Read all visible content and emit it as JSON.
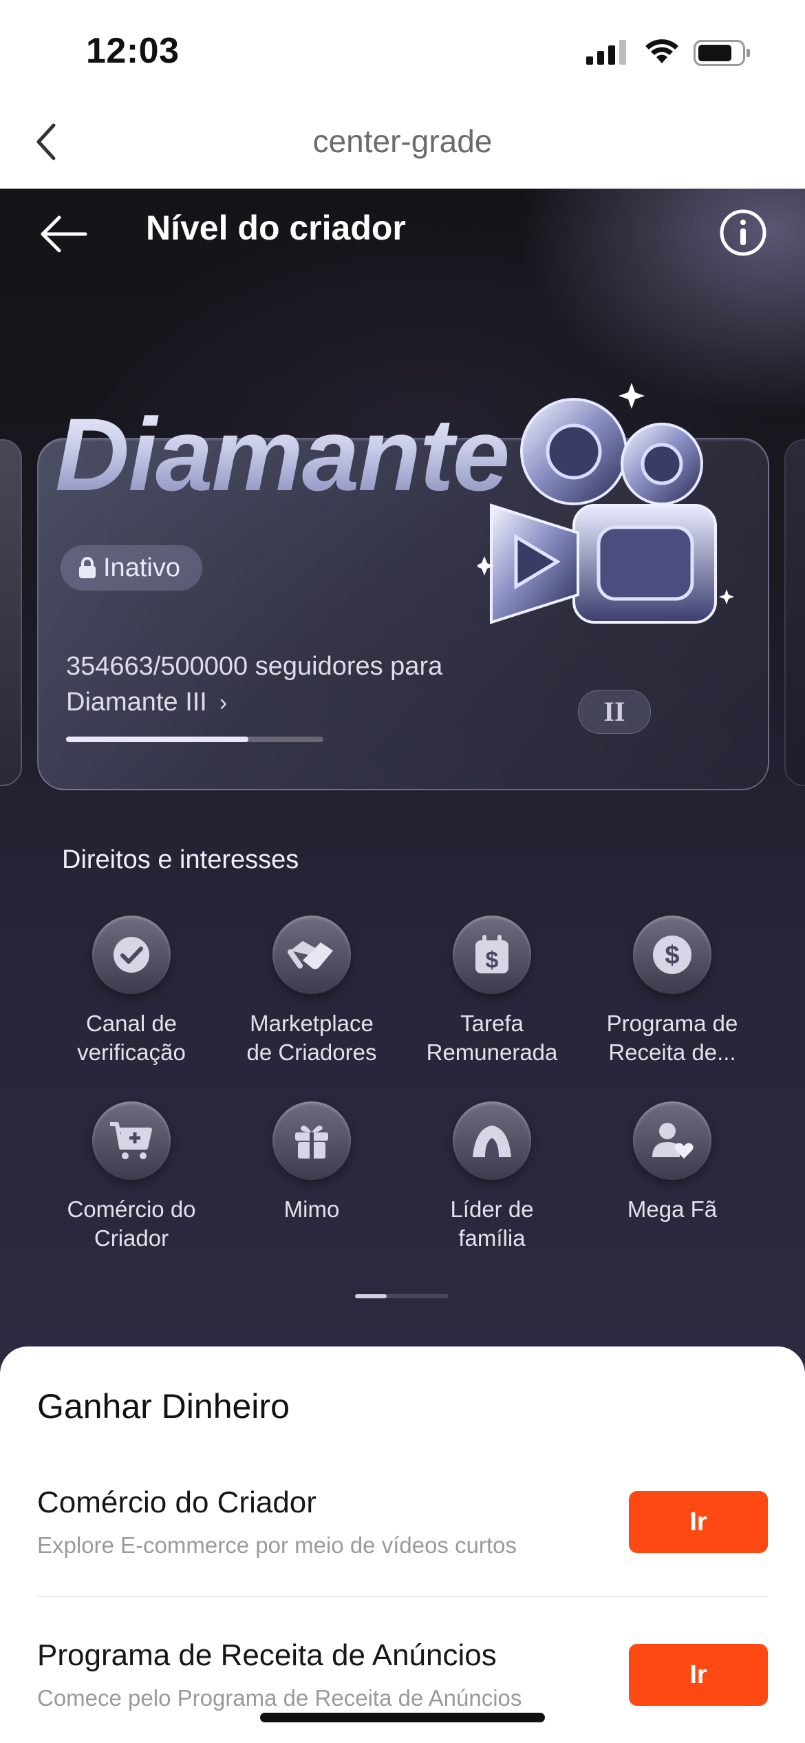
{
  "status_bar": {
    "time": "12:03"
  },
  "nav": {
    "title": "center-grade"
  },
  "hero": {
    "title": "Nível do criador"
  },
  "level_card": {
    "tier_name": "Diamante",
    "status_badge": "Inativo",
    "followers_line1": "354663/500000 seguidores para",
    "followers_line2": "Diamante III",
    "followers_current": 354663,
    "followers_target": 500000,
    "tier_label": "II"
  },
  "rights": {
    "title": "Direitos e interesses",
    "items": [
      {
        "line1": "Canal de",
        "line2": "verificação",
        "icon": "check-icon"
      },
      {
        "line1": "Marketplace",
        "line2": "de Criadores",
        "icon": "handshake-icon"
      },
      {
        "line1": "Tarefa",
        "line2": "Remunerada",
        "icon": "calendar-dollar-icon"
      },
      {
        "line1": "Programa de",
        "line2": "Receita de...",
        "icon": "dollar-coin-icon"
      },
      {
        "line1": "Comércio do",
        "line2": "Criador",
        "icon": "cart-icon"
      },
      {
        "line1": "Mimo",
        "line2": "",
        "icon": "gift-icon"
      },
      {
        "line1": "Líder de",
        "line2": "família",
        "icon": "family-tent-icon"
      },
      {
        "line1": "Mega Fã",
        "line2": "",
        "icon": "user-heart-icon"
      }
    ]
  },
  "earn": {
    "title": "Ganhar Dinheiro",
    "rows": [
      {
        "title": "Comércio do Criador",
        "subtitle": "Explore E-commerce por meio de vídeos curtos",
        "button": "Ir"
      },
      {
        "title": "Programa de Receita de Anúncios",
        "subtitle": "Comece pelo Programa de Receita de Anúncios",
        "button": "Ir"
      }
    ]
  },
  "colors": {
    "accent": "#fe4a12",
    "hero_dark": "#1a1820"
  }
}
